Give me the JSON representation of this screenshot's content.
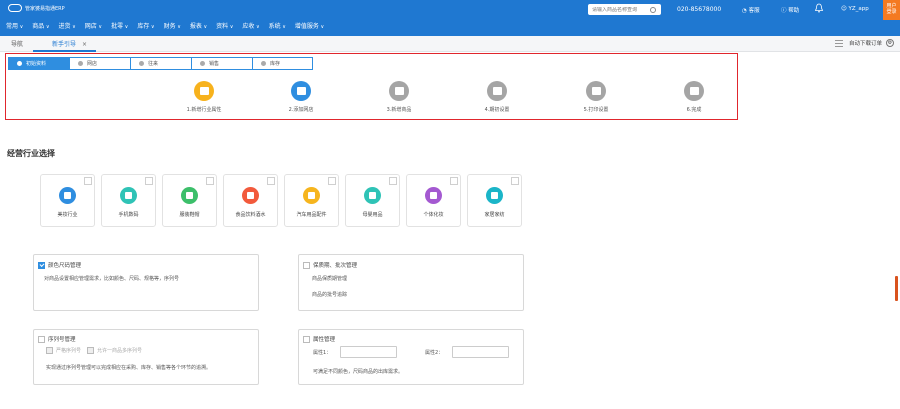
{
  "app": {
    "logo_text": "管家婆易指通ERP",
    "search_placeholder": "请输入商品名称查询",
    "phone": "020-85678000",
    "customer_service": "客服",
    "help": "帮助",
    "user": "YZ_app",
    "user_center": "用户\n登录"
  },
  "nav": [
    {
      "label": "常用"
    },
    {
      "label": "商品"
    },
    {
      "label": "进货"
    },
    {
      "label": "网店"
    },
    {
      "label": "批零"
    },
    {
      "label": "库存"
    },
    {
      "label": "财务"
    },
    {
      "label": "报表"
    },
    {
      "label": "资料"
    },
    {
      "label": "应收"
    },
    {
      "label": "系统"
    },
    {
      "label": "增值服务"
    }
  ],
  "tabs": {
    "home": "导航",
    "current": "新手引导",
    "close": "×",
    "right_option": "自动下载订单"
  },
  "guide": {
    "tabs": [
      {
        "label": "初始资料",
        "active": true
      },
      {
        "label": "网店",
        "active": false
      },
      {
        "label": "往来",
        "active": false
      },
      {
        "label": "销售",
        "active": false
      },
      {
        "label": "库存",
        "active": false
      }
    ],
    "steps": [
      {
        "label": "1.新增行业属性",
        "icon": "gift-icon",
        "color": "#f7b21d"
      },
      {
        "label": "2.添加网店",
        "icon": "store-icon",
        "color": "#2f8ee0"
      },
      {
        "label": "3.新增商品",
        "icon": "bag-icon",
        "color": "#a5a5a5"
      },
      {
        "label": "4.期初设置",
        "icon": "box-icon",
        "color": "#a5a5a5"
      },
      {
        "label": "5.打印设置",
        "icon": "printer-icon",
        "color": "#a5a5a5"
      },
      {
        "label": "6.完成",
        "icon": "check-icon",
        "color": "#a5a5a5"
      }
    ]
  },
  "industry": {
    "title": "经营行业选择",
    "items": [
      {
        "label": "美妆行业",
        "icon": "grid-icon",
        "color": "#2f8ee0"
      },
      {
        "label": "手机数码",
        "icon": "camera-icon",
        "color": "#2fc3b6"
      },
      {
        "label": "服装鞋帽",
        "icon": "shirt-icon",
        "color": "#3cbf6a"
      },
      {
        "label": "食品饮料酒水",
        "icon": "food-icon",
        "color": "#f25a3c"
      },
      {
        "label": "汽车用品配件",
        "icon": "car-icon",
        "color": "#f6b51e"
      },
      {
        "label": "母婴用品",
        "icon": "bottle-icon",
        "color": "#2fc3b6"
      },
      {
        "label": "个体化妆",
        "icon": "drop-icon",
        "color": "#a459d1"
      },
      {
        "label": "家居家纺",
        "icon": "home-icon",
        "color": "#1bb5c8"
      }
    ]
  },
  "panels": {
    "color_size": {
      "title": "颜色尺码管理",
      "checked": true,
      "desc": "对商品设置相应管理需求，比如颜色、尺码、规格等，序列号"
    },
    "shelf_life": {
      "title": "保质期、批次管理",
      "checked": false,
      "line1": "商品保质期管理",
      "line2": "商品的批号追踪"
    },
    "serial": {
      "title": "序列号管理",
      "checked": false,
      "opt1": "严格序列号",
      "opt2": "允许一商品多序列号",
      "desc": "实现通过序列号管理可以完成相应在采购、库存、销售等各个环节的追溯。"
    },
    "attribute": {
      "title": "属性管理",
      "checked": false,
      "attr1": "属性1：",
      "attr2": "属性2：",
      "attr1_value": "",
      "attr2_value": "",
      "desc": "可满足不同颜色，尺码商品的出库需求。"
    }
  },
  "colors": {
    "primary": "#1f78d1",
    "accent": "#2f8ee0",
    "highlight_border": "#e0262d",
    "user_center": "#f47a21"
  }
}
